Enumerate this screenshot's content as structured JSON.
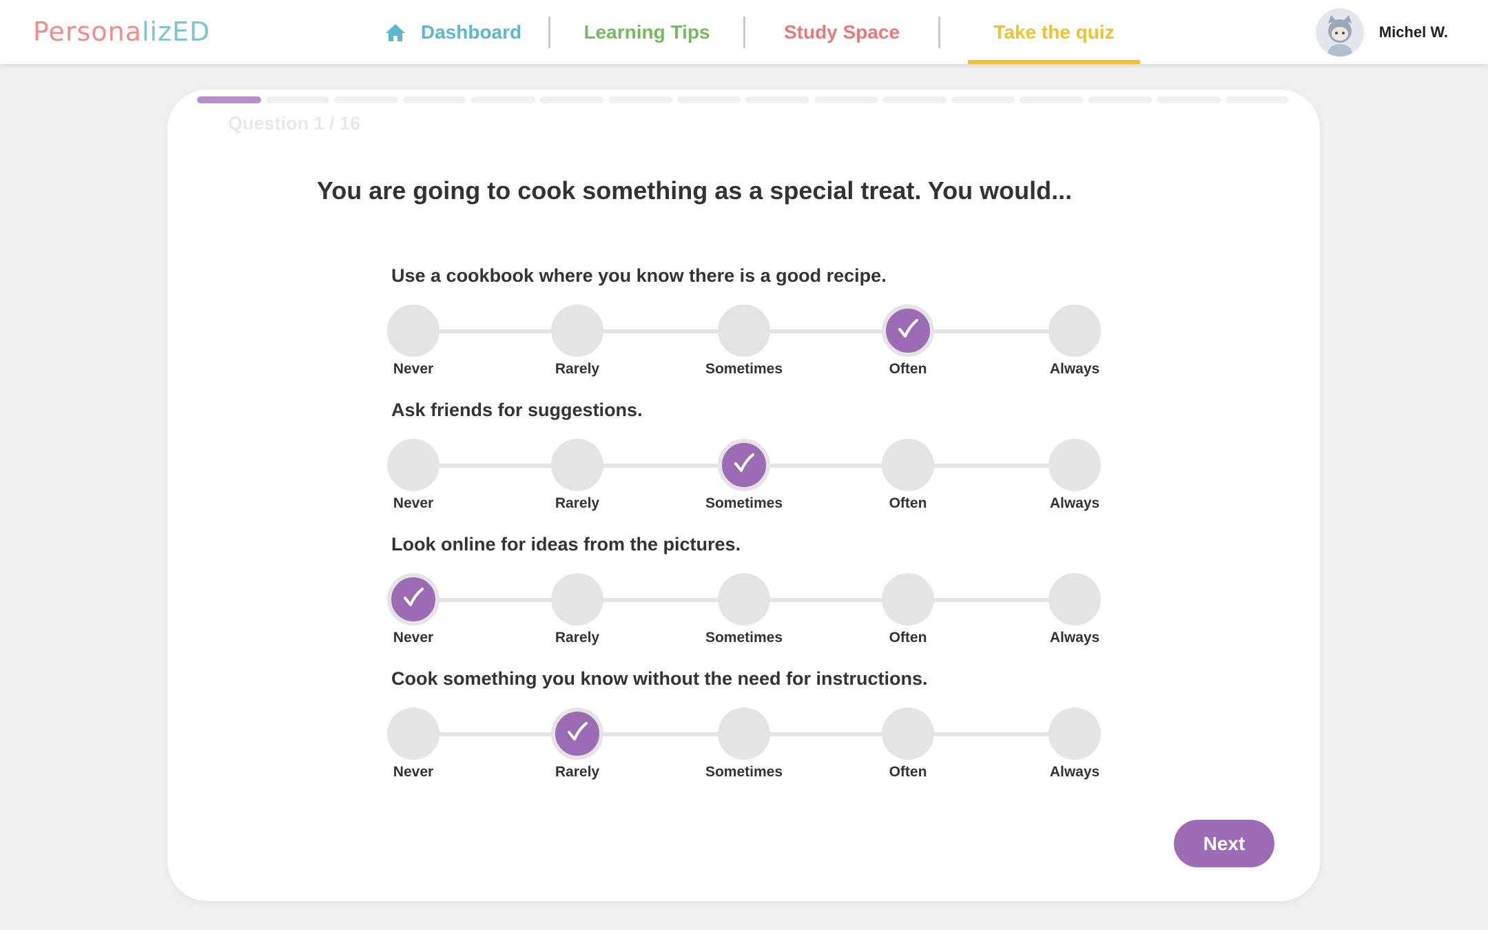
{
  "brand": {
    "logo_part1": "Per",
    "logo_part2": "sona",
    "logo_part3": "lizED"
  },
  "nav": {
    "dashboard": "Dashboard",
    "learning_tips": "Learning Tips",
    "study_space": "Study Space",
    "take_quiz": "Take the quiz",
    "active": "Take the quiz"
  },
  "user": {
    "name": "Michel W.",
    "avatar_icon": "avatar-icon"
  },
  "quiz": {
    "progress": {
      "current": 1,
      "total": 16
    },
    "question_counter": "Question 1 / 16",
    "question": "You are going to cook something as a special treat. You would...",
    "scale_labels": [
      "Never",
      "Rarely",
      "Sometimes",
      "Often",
      "Always"
    ],
    "statements": [
      {
        "text": "Use a cookbook where you know there is a good recipe.",
        "selected": "Often"
      },
      {
        "text": "Ask friends for suggestions.",
        "selected": "Sometimes"
      },
      {
        "text": "Look online for ideas from the pictures.",
        "selected": "Never"
      },
      {
        "text": "Cook something you know without the need for instructions.",
        "selected": "Rarely"
      }
    ],
    "next_label": "Next"
  },
  "colors": {
    "accent_purple": "#9c6db5",
    "progress_active": "#b68ec9",
    "dashboard": "#5bb8cf",
    "learning_tips": "#74ba5e",
    "study_space": "#e97a78",
    "take_quiz": "#f2c12d"
  }
}
